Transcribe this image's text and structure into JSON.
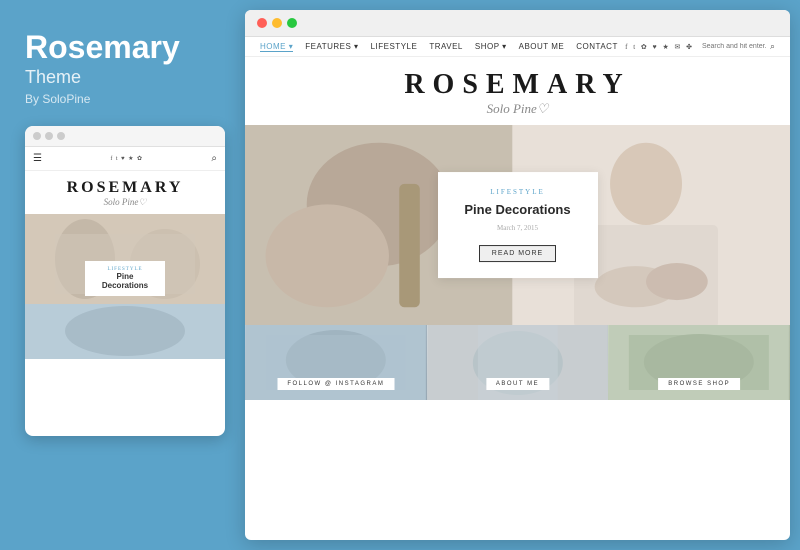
{
  "left": {
    "title": "Rosemary",
    "subtitle": "Theme",
    "author": "By SoloPine"
  },
  "mobile": {
    "logo": "ROSEMARY",
    "logo_sub": "Solo Pine♡",
    "nav_dots": [
      "●",
      "●",
      "●"
    ],
    "hero_category": "LIFESTYLE",
    "hero_title": "Pine Decorations"
  },
  "desktop": {
    "browser_dots": [
      "red",
      "yellow",
      "green"
    ],
    "nav": {
      "links": [
        "HOME ▾",
        "FEATURES ▾",
        "LIFESTYLE",
        "TRAVEL",
        "SHOP ▾",
        "ABOUT ME",
        "CONTACT"
      ],
      "search_placeholder": "Search and hit enter...",
      "social_icons": "f t ♥ ✉ ♦ ✿ ★ ✤"
    },
    "logo": "ROSEMARY",
    "logo_sub": "Solo Pine♡",
    "hero": {
      "category": "LIFESTYLE",
      "title": "Pine Decorations",
      "date": "March 7, 2015",
      "button": "READ MORE"
    },
    "grid": [
      {
        "label": "FOLLOW @ INSTAGRAM"
      },
      {
        "label": "ABOUT ME"
      },
      {
        "label": "BROWSE SHOP"
      }
    ]
  }
}
